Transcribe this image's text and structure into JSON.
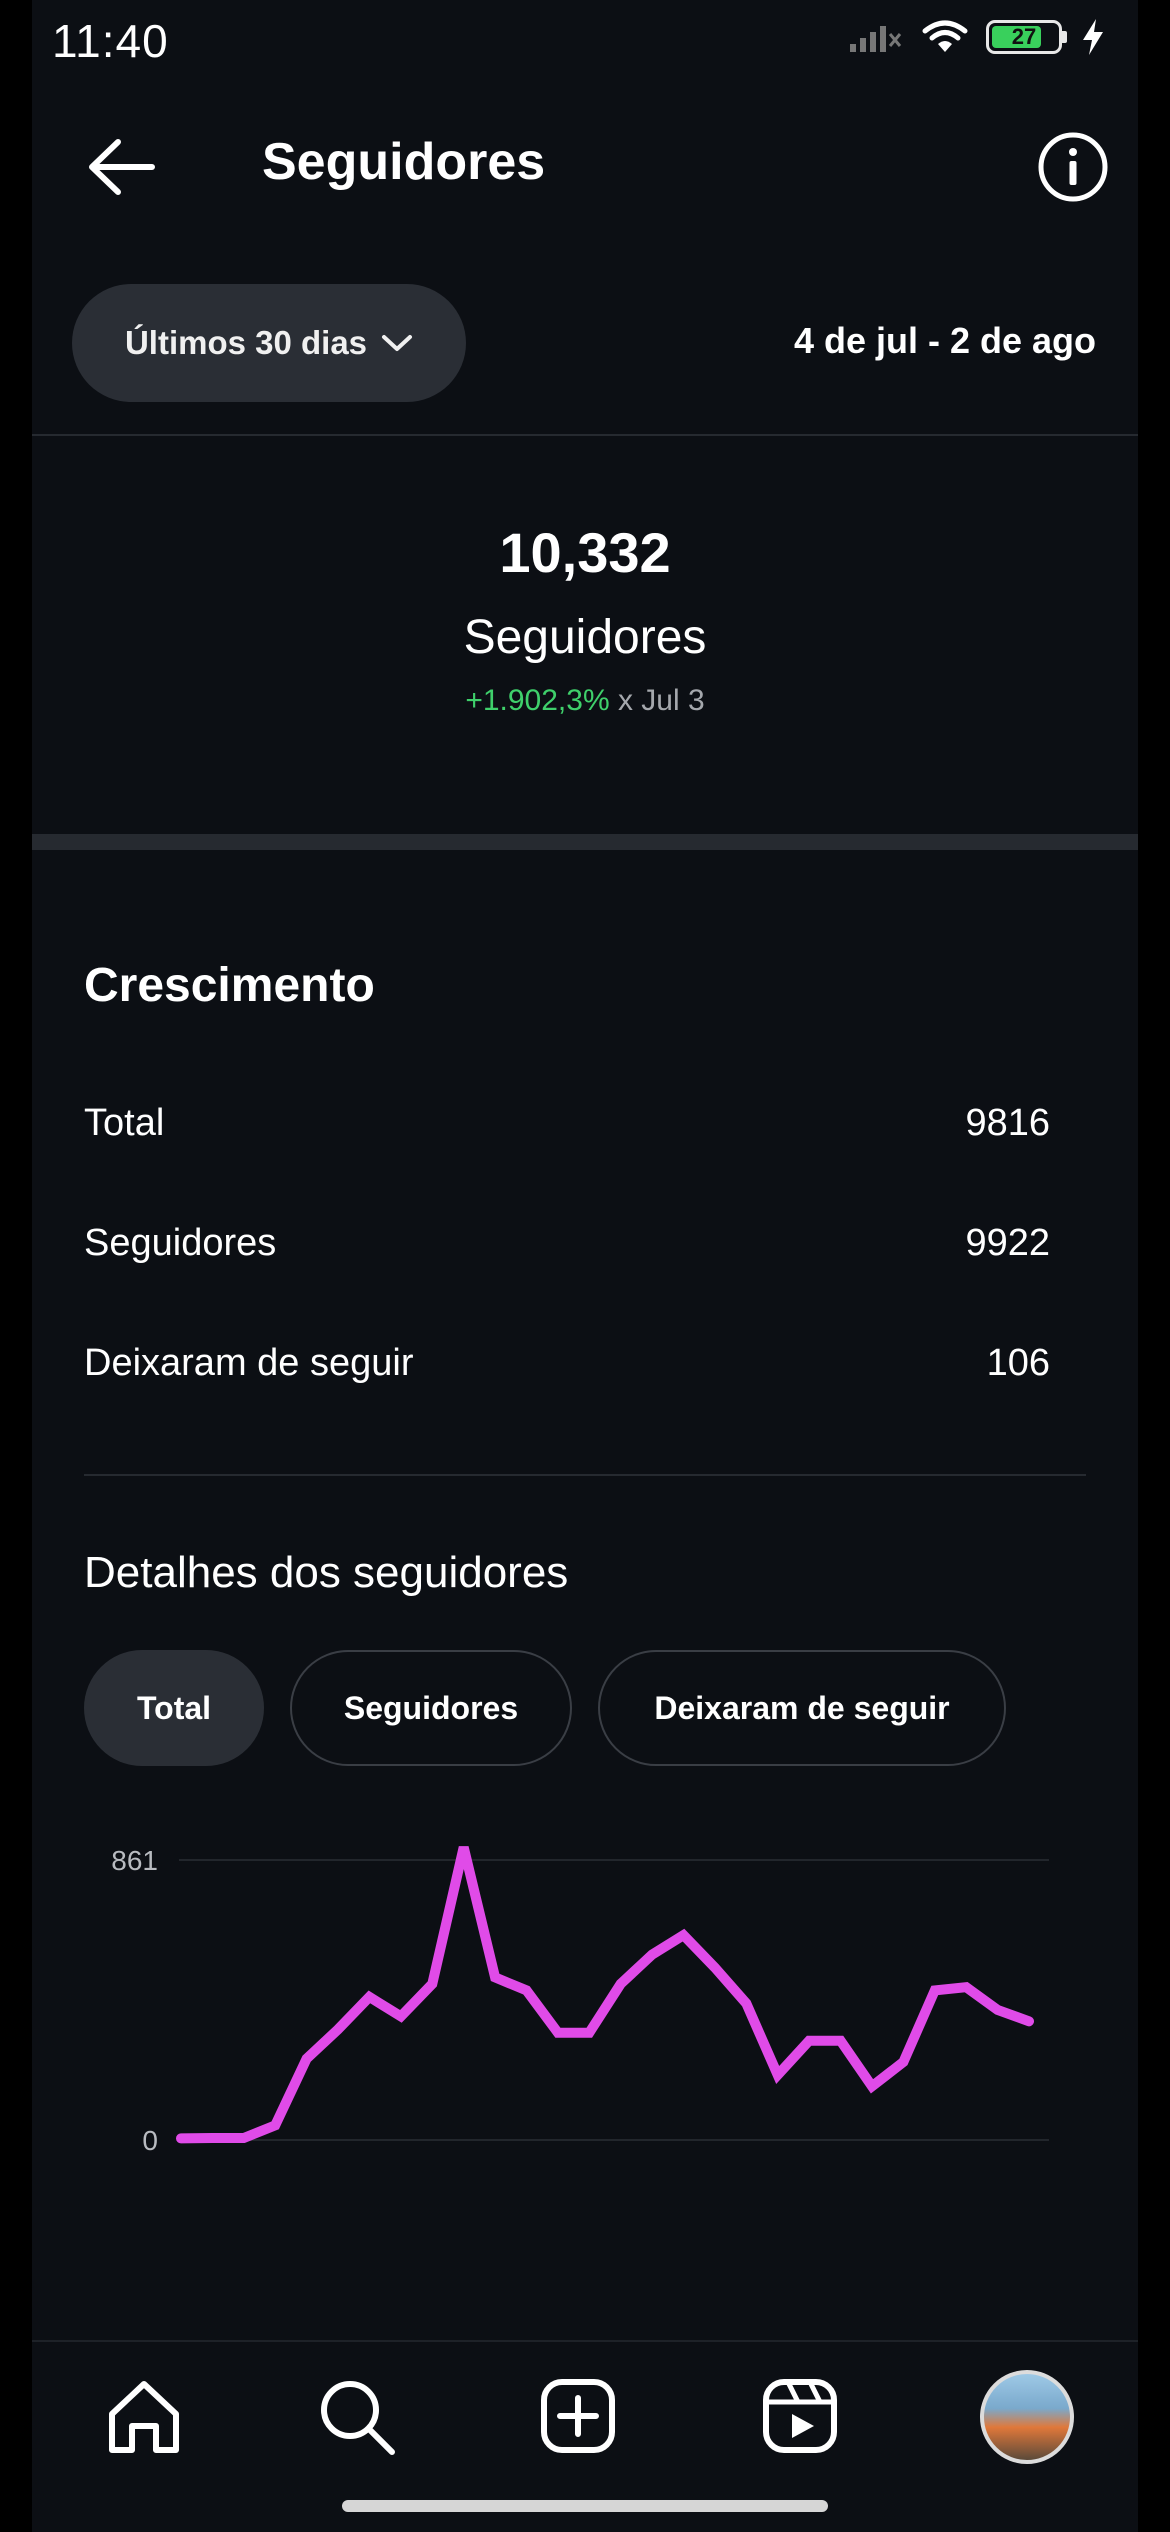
{
  "status_bar": {
    "time": "11:40",
    "battery": "27"
  },
  "header": {
    "title": "Seguidores"
  },
  "filter": {
    "range_label": "Últimos 30 dias",
    "date_range": "4 de jul - 2 de ago"
  },
  "summary": {
    "count": "10,332",
    "label": "Seguidores",
    "change": "+1.902,3%",
    "change_suffix": " x Jul 3",
    "change_color": "#3fd06b"
  },
  "growth": {
    "title": "Crescimento",
    "rows": [
      {
        "label": "Total",
        "value": "9816"
      },
      {
        "label": "Seguidores",
        "value": "9922"
      },
      {
        "label": "Deixaram de seguir",
        "value": "106"
      }
    ]
  },
  "details": {
    "title": "Detalhes dos seguidores",
    "tabs": [
      "Total",
      "Seguidores",
      "Deixaram de seguir"
    ],
    "active_tab": "Total"
  },
  "chart_data": {
    "type": "line",
    "y_ticks": [
      "861",
      "0"
    ],
    "ylim": [
      0,
      861
    ],
    "grid": true,
    "line_color": "#e04be8",
    "series": [
      {
        "values": [
          5,
          6,
          6,
          45,
          250,
          340,
          440,
          380,
          480,
          900,
          500,
          460,
          330,
          330,
          480,
          570,
          630,
          530,
          420,
          200,
          305,
          305,
          165,
          240,
          460,
          470,
          400,
          365
        ]
      }
    ]
  },
  "nav": {
    "items": [
      "home-icon",
      "search-icon",
      "create-icon",
      "reels-icon",
      "profile-avatar"
    ]
  }
}
